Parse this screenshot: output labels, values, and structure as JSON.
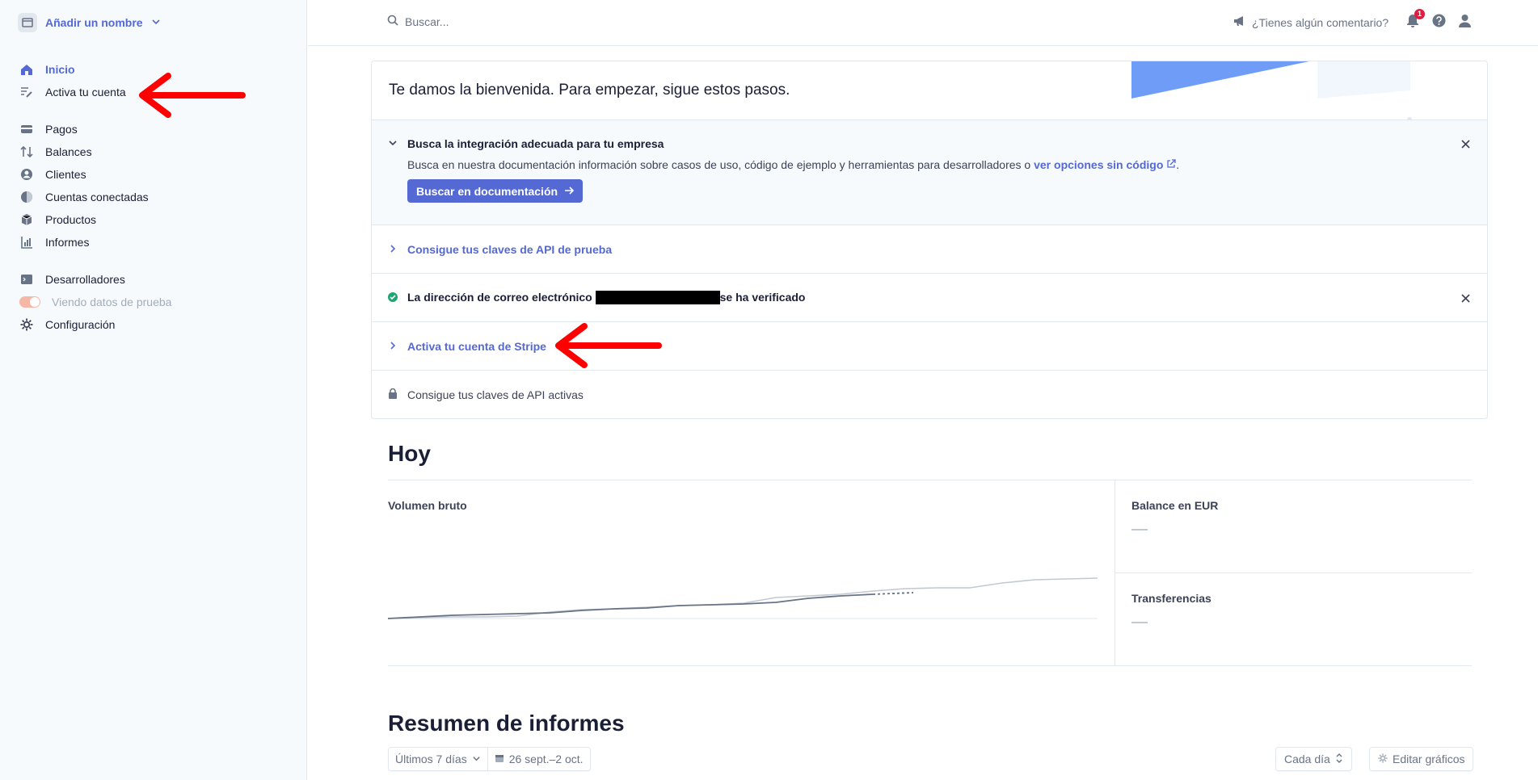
{
  "sidebar": {
    "account_name": "Añadir un nombre",
    "items": [
      {
        "label": "Inicio"
      },
      {
        "label": "Activa tu cuenta"
      },
      {
        "label": "Pagos"
      },
      {
        "label": "Balances"
      },
      {
        "label": "Clientes"
      },
      {
        "label": "Cuentas conectadas"
      },
      {
        "label": "Productos"
      },
      {
        "label": "Informes"
      },
      {
        "label": "Desarrolladores"
      },
      {
        "label": "Viendo datos de prueba"
      },
      {
        "label": "Configuración"
      }
    ]
  },
  "topbar": {
    "search_placeholder": "Buscar...",
    "feedback_label": "¿Tienes algún comentario?",
    "notification_count": "1"
  },
  "onboarding": {
    "welcome": "Te damos la bienvenida. Para empezar, sigue estos pasos.",
    "integration_title": "Busca la integración adecuada para tu empresa",
    "integration_desc": "Busca en nuestra documentación información sobre casos de uso, código de ejemplo y herramientas para desarrolladores o ",
    "integration_link": "ver opciones sin código",
    "integration_desc_end": ".",
    "docs_button": "Buscar en documentación",
    "test_keys": "Consigue tus claves de API de prueba",
    "email_prefix": "La dirección de correo electrónico",
    "email_suffix": "se ha verificado",
    "activate_stripe": "Activa tu cuenta de Stripe",
    "live_keys": "Consigue tus claves de API activas"
  },
  "today": {
    "heading": "Hoy",
    "gross_volume": "Volumen bruto",
    "balance_eur": "Balance en EUR",
    "balance_value": "—",
    "transfers": "Transferencias",
    "transfers_value": "—"
  },
  "reports": {
    "heading": "Resumen de informes",
    "range": "Últimos 7 días",
    "dates": "26 sept.–2 oct.",
    "interval": "Cada día",
    "edit_charts": "Editar gráficos"
  },
  "colors": {
    "accent": "#5469d4",
    "annotation_arrow": "#ff0000",
    "success": "#1ea672"
  }
}
